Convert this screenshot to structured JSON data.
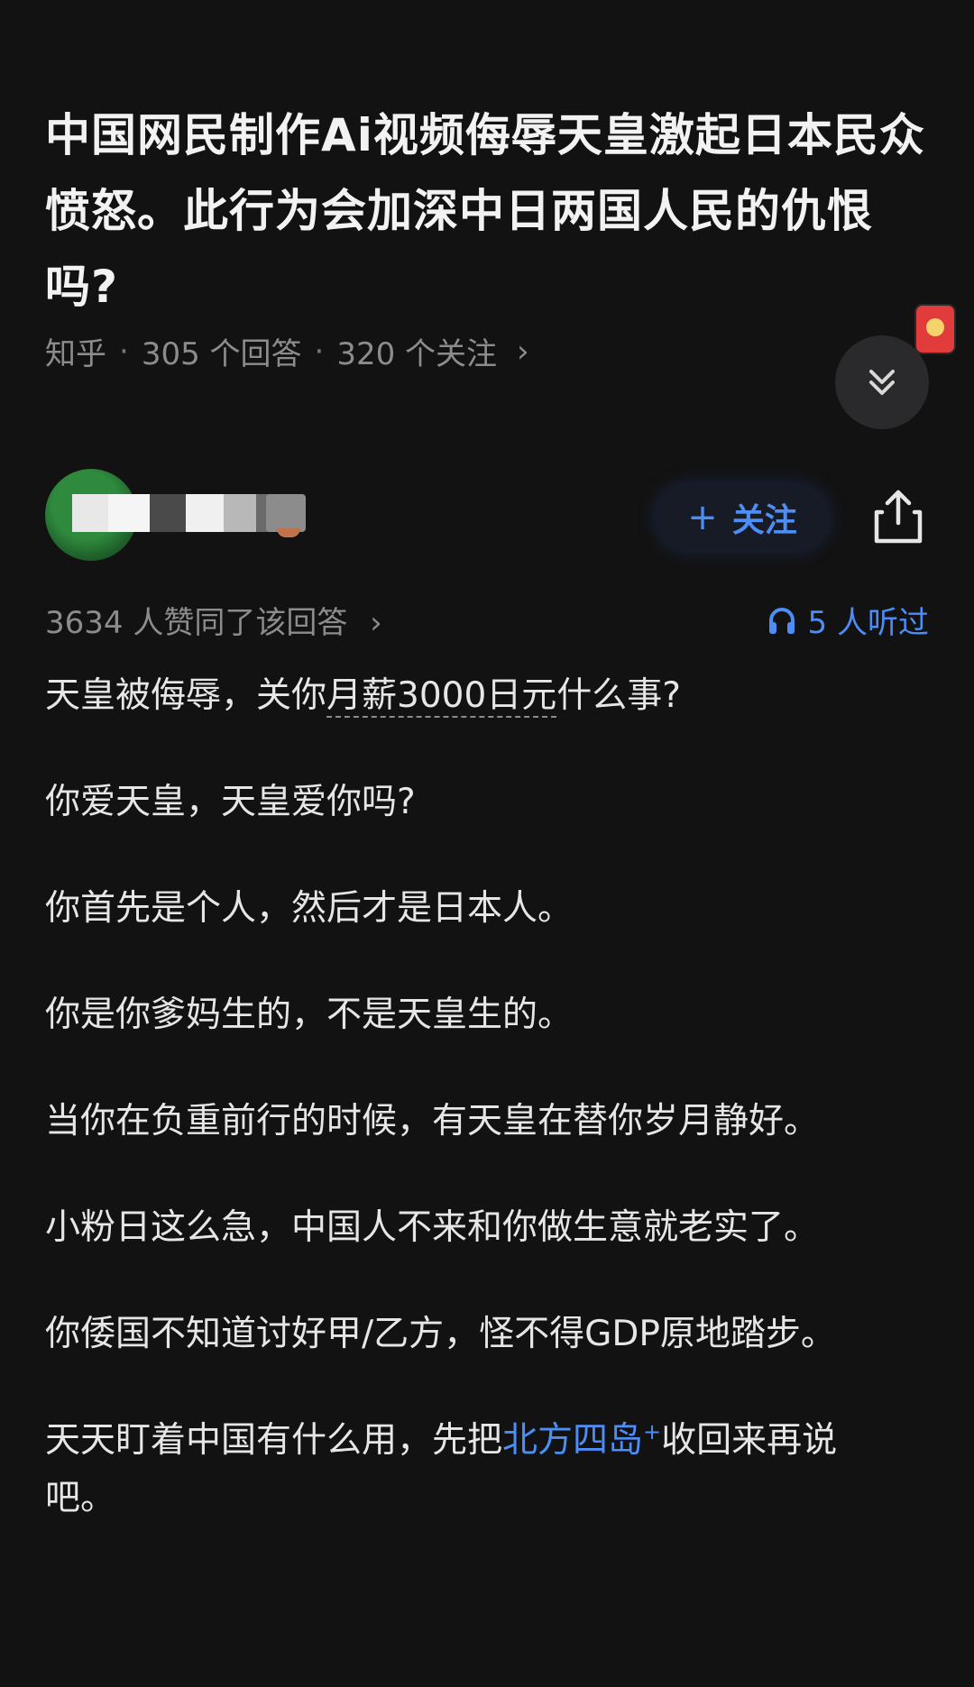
{
  "question": {
    "title": "中国网民制作Ai视频侮辱天皇激起日本民众愤怒。此行为会加深中日两国人民的仇恨吗?",
    "source": "知乎",
    "answers_count": "305 个回答",
    "followers_count": "320 个关注",
    "meta_chevron": "›"
  },
  "icons": {
    "red_packet": "red-packet-icon",
    "collapse": "double-chevron-down-icon",
    "share": "share-icon",
    "headphones": "headphones-icon",
    "plus": "plus-icon"
  },
  "author": {
    "follow_label": "关注",
    "follow_plus": "+"
  },
  "stats": {
    "upvotes_text": "3634 人赞同了该回答",
    "upvotes_chevron": "›",
    "listened_text": "5 人听过"
  },
  "answer": {
    "p1_before": "天皇被侮辱，关你",
    "p1_dashed": "月薪3000日元",
    "p1_after": "什么事?",
    "p2": "你爱天皇，天皇爱你吗?",
    "p3": "你首先是个人，然后才是日本人。",
    "p4": "你是你爹妈生的，不是天皇生的。",
    "p5": "当你在负重前行的时候，有天皇在替你岁月静好。",
    "p6": "小粉日这么急，中国人不来和你做生意就老实了。",
    "p7": "你倭国不知道讨好甲/乙方，怪不得GDP原地踏步。",
    "p8_before": "天天盯着中国有什么用，先把",
    "p8_link": "北方四岛",
    "p8_sup": "+",
    "p8_after": "收回来再说吧。"
  },
  "colors": {
    "background": "#121212",
    "accent_blue": "#4c8df6",
    "muted_text": "#8c8c8c",
    "red_packet": "#e23b3b"
  }
}
